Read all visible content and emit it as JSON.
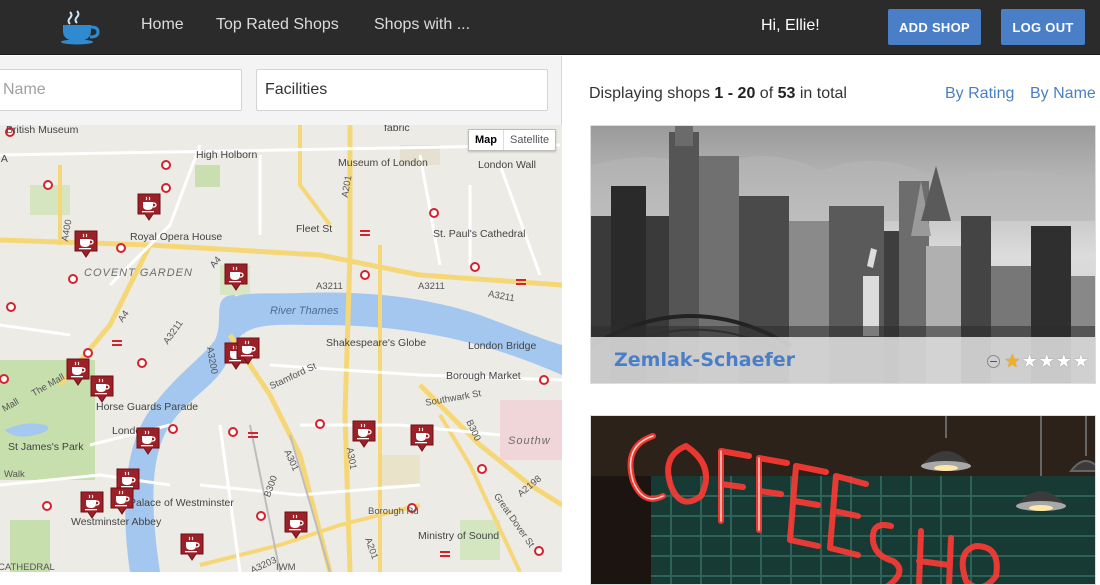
{
  "nav": {
    "links": [
      "Home",
      "Top Rated Shops",
      "Shops with ..."
    ],
    "greeting": "Hi, Ellie!",
    "add_shop": "ADD SHOP",
    "log_out": "LOG OUT",
    "logo_icon": "coffee-cup-icon"
  },
  "filters": {
    "name_placeholder": "Name",
    "facilities_value": "Facilities"
  },
  "map": {
    "type_options": [
      "Map",
      "Satellite"
    ],
    "selected_type": "Map",
    "labels": {
      "british_museum": "British Museum",
      "high_holborn": "High Holborn",
      "museum_of_london": "Museum of London",
      "london_wall": "London Wall",
      "fabric": "fabric",
      "royal_opera_house": "Royal Opera House",
      "fleet_st": "Fleet St",
      "st_pauls": "St. Paul's Cathedral",
      "covent_garden": "COVENT GARDEN",
      "river_thames": "River Thames",
      "shakespeares_globe": "Shakespeare's Globe",
      "london_bridge": "London Bridge",
      "stamford_st": "Stamford St",
      "borough_market": "Borough Market",
      "southwark_st": "Southwark St",
      "horse_guards": "Horse Guards Parade",
      "london_eye": "London",
      "st_james_park": "St James's Park",
      "southwark": "Southw",
      "palace_of_westminster": "Palace of Westminster",
      "westminster_abbey": "Westminster Abbey",
      "borough_rd": "Borough Rd",
      "ministry_of_sound": "Ministry of Sound",
      "great_dover_st": "Great Dover St",
      "the_mall": "The Mall",
      "mall": "Mall",
      "walk": "Walk",
      "ia": "IA",
      "iwm": "IWM",
      "cathedral": "CATHEDRAL"
    },
    "roads": [
      "A400",
      "A4",
      "A201",
      "A4",
      "A3211",
      "A3211",
      "A3211",
      "A3211",
      "A3200",
      "A301",
      "B300",
      "B300",
      "A2198",
      "A3203",
      "A201",
      "A301"
    ],
    "pin_icon": "coffee-shop-pin-icon"
  },
  "results": {
    "prefix": "Displaying shops",
    "range_start": "1",
    "dash": "-",
    "range_end": "20",
    "of": "of",
    "total": "53",
    "suffix": "in total",
    "sort_by_rating": "By Rating",
    "sort_by_name": "By Name"
  },
  "shops": [
    {
      "name": "Zemlak-Schaefer",
      "rating": 1,
      "max_rating": 5
    },
    {
      "name": "",
      "rating": 0,
      "max_rating": 5
    }
  ],
  "colors": {
    "navbar": "#2b2b2b",
    "accent": "#4a7fc8",
    "pin": "#9c2027",
    "star": "#f2b01e"
  }
}
